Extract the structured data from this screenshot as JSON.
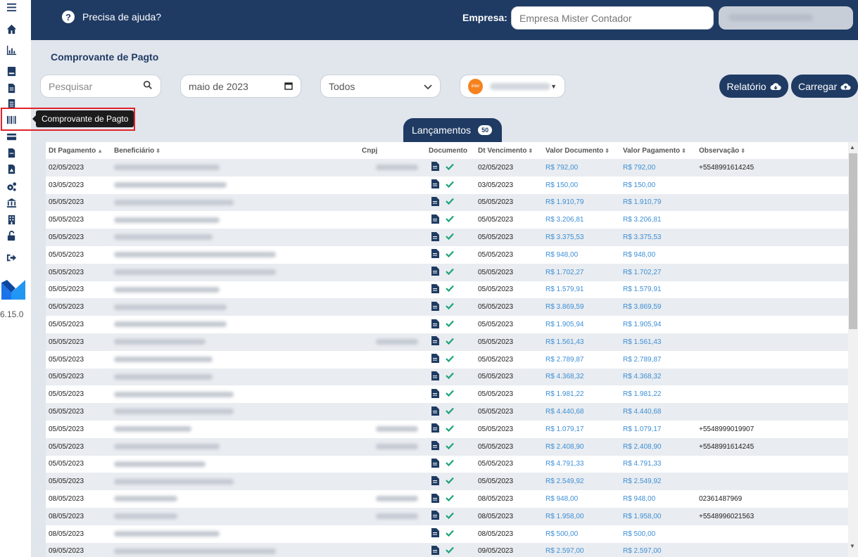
{
  "header": {
    "help_text": "Precisa de ajuda?",
    "empresa_label": "Empresa:",
    "empresa_placeholder": "Empresa Mister Contador"
  },
  "sidebar": {
    "tooltip": "Comprovante de Pagto",
    "version": "6.15.0",
    "icons": [
      "menu-icon",
      "home-icon",
      "chart-icon",
      "book-icon",
      "document-icon",
      "document-list-icon",
      "barcode-icon",
      "card-icon",
      "file-icon",
      "pdf-icon",
      "gears-icon",
      "bank-icon",
      "building-icon",
      "unlock-icon",
      "logout-icon"
    ]
  },
  "page": {
    "title": "Comprovante de Pagto",
    "search_placeholder": "Pesquisar",
    "month_value": "maio de 2023",
    "status_select": "Todos",
    "bank_badge": "inter",
    "report_button": "Relatório",
    "load_button": "Carregar"
  },
  "tab": {
    "label": "Lançamentos",
    "count": "50"
  },
  "table": {
    "headers": [
      "Dt Pagamento",
      "Beneficiário",
      "Cnpj",
      "Documento",
      "Dt Vencimento",
      "Valor Documento",
      "Valor Pagamento",
      "Observação"
    ],
    "rows": [
      [
        "02/05/2023",
        "",
        "",
        "",
        "02/05/2023",
        "R$ 792,00",
        "R$ 792,00",
        "+5548991614245"
      ],
      [
        "03/05/2023",
        "",
        "",
        "",
        "03/05/2023",
        "R$ 150,00",
        "R$ 150,00",
        ""
      ],
      [
        "05/05/2023",
        "",
        "",
        "",
        "05/05/2023",
        "R$ 1.910,79",
        "R$ 1.910,79",
        ""
      ],
      [
        "05/05/2023",
        "",
        "",
        "",
        "05/05/2023",
        "R$ 3.206,81",
        "R$ 3.206,81",
        ""
      ],
      [
        "05/05/2023",
        "",
        "",
        "",
        "05/05/2023",
        "R$ 3.375,53",
        "R$ 3.375,53",
        ""
      ],
      [
        "05/05/2023",
        "",
        "",
        "",
        "05/05/2023",
        "R$ 948,00",
        "R$ 948,00",
        ""
      ],
      [
        "05/05/2023",
        "",
        "",
        "",
        "05/05/2023",
        "R$ 1.702,27",
        "R$ 1.702,27",
        ""
      ],
      [
        "05/05/2023",
        "",
        "",
        "",
        "05/05/2023",
        "R$ 1.579,91",
        "R$ 1.579,91",
        ""
      ],
      [
        "05/05/2023",
        "",
        "",
        "",
        "05/05/2023",
        "R$ 3.869,59",
        "R$ 3.869,59",
        ""
      ],
      [
        "05/05/2023",
        "",
        "",
        "",
        "05/05/2023",
        "R$ 1.905,94",
        "R$ 1.905,94",
        ""
      ],
      [
        "05/05/2023",
        "",
        "",
        "",
        "05/05/2023",
        "R$ 1.561,43",
        "R$ 1.561,43",
        ""
      ],
      [
        "05/05/2023",
        "",
        "",
        "",
        "05/05/2023",
        "R$ 2.789,87",
        "R$ 2.789,87",
        ""
      ],
      [
        "05/05/2023",
        "",
        "",
        "",
        "05/05/2023",
        "R$ 4.368,32",
        "R$ 4.368,32",
        ""
      ],
      [
        "05/05/2023",
        "",
        "",
        "",
        "05/05/2023",
        "R$ 1.981,22",
        "R$ 1.981,22",
        ""
      ],
      [
        "05/05/2023",
        "",
        "",
        "",
        "05/05/2023",
        "R$ 4.440,68",
        "R$ 4.440,68",
        ""
      ],
      [
        "05/05/2023",
        "",
        "",
        "",
        "05/05/2023",
        "R$ 1.079,17",
        "R$ 1.079,17",
        "+5548999019907"
      ],
      [
        "05/05/2023",
        "",
        "",
        "",
        "05/05/2023",
        "R$ 2.408,90",
        "R$ 2.408,90",
        "+5548991614245"
      ],
      [
        "05/05/2023",
        "",
        "",
        "",
        "05/05/2023",
        "R$ 4.791,33",
        "R$ 4.791,33",
        ""
      ],
      [
        "05/05/2023",
        "",
        "",
        "",
        "05/05/2023",
        "R$ 2.549,92",
        "R$ 2.549,92",
        ""
      ],
      [
        "08/05/2023",
        "",
        "",
        "",
        "08/05/2023",
        "R$ 948,00",
        "R$ 948,00",
        "02361487969"
      ],
      [
        "08/05/2023",
        "",
        "",
        "",
        "08/05/2023",
        "R$ 1.958,00",
        "R$ 1.958,00",
        "+5548996021563"
      ],
      [
        "08/05/2023",
        "",
        "",
        "",
        "08/05/2023",
        "R$ 500,00",
        "R$ 500,00",
        ""
      ],
      [
        "09/05/2023",
        "",
        "",
        "",
        "09/05/2023",
        "R$ 2.597,00",
        "R$ 2.597,00",
        ""
      ]
    ]
  }
}
